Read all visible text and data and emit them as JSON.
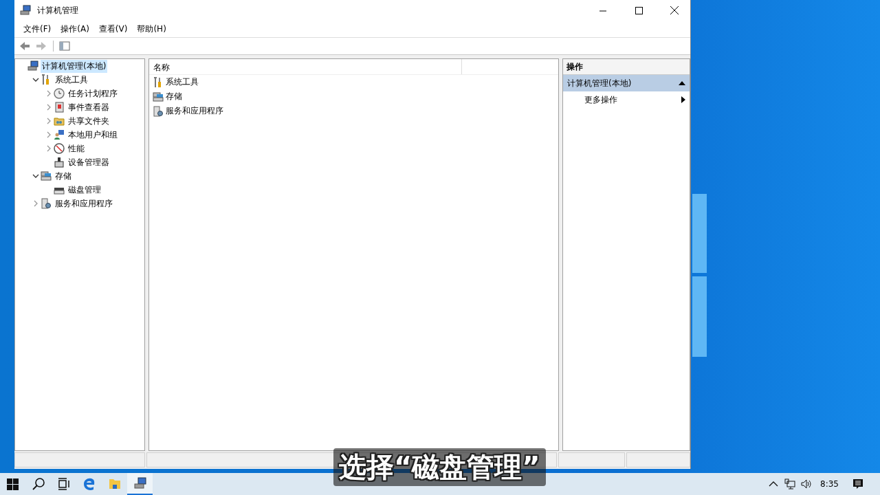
{
  "window": {
    "title": "计算机管理"
  },
  "menu": [
    "文件(F)",
    "操作(A)",
    "查看(V)",
    "帮助(H)"
  ],
  "tree": [
    {
      "label": "计算机管理(本地)",
      "kind": "computer",
      "selected": true,
      "children": [
        {
          "label": "系统工具",
          "kind": "tools",
          "selected": false,
          "expanded": true,
          "children": [
            {
              "label": "任务计划程序",
              "kind": "clock",
              "selected": false,
              "expanded": false
            },
            {
              "label": "事件查看器",
              "kind": "event-log",
              "selected": false,
              "expanded": false
            },
            {
              "label": "共享文件夹",
              "kind": "shared-folder",
              "selected": false,
              "expanded": false
            },
            {
              "label": "本地用户和组",
              "kind": "users",
              "selected": false,
              "expanded": false
            },
            {
              "label": "性能",
              "kind": "performance",
              "selected": false,
              "expanded": false
            },
            {
              "label": "设备管理器",
              "kind": "device",
              "selected": false
            }
          ]
        },
        {
          "label": "存储",
          "kind": "storage",
          "selected": false,
          "expanded": true,
          "children": [
            {
              "label": "磁盘管理",
              "kind": "disk",
              "selected": false
            }
          ]
        },
        {
          "label": "服务和应用程序",
          "kind": "services",
          "selected": false,
          "expanded": false
        }
      ]
    }
  ],
  "list": {
    "columns": [
      "名称"
    ],
    "rows": [
      {
        "label": "系统工具",
        "kind": "tools"
      },
      {
        "label": "存储",
        "kind": "storage"
      },
      {
        "label": "服务和应用程序",
        "kind": "services"
      }
    ]
  },
  "actions": {
    "header": "操作",
    "section": "计算机管理(本地)",
    "items": [
      "更多操作"
    ]
  },
  "caption": "选择“磁盘管理”",
  "taskbar": {
    "apps": [
      {
        "kind": "search",
        "selected": false
      },
      {
        "kind": "task-view",
        "selected": false
      },
      {
        "kind": "browser",
        "selected": false
      },
      {
        "kind": "folder",
        "selected": false
      },
      {
        "kind": "computer",
        "selected": true
      }
    ],
    "time": "8:35"
  }
}
